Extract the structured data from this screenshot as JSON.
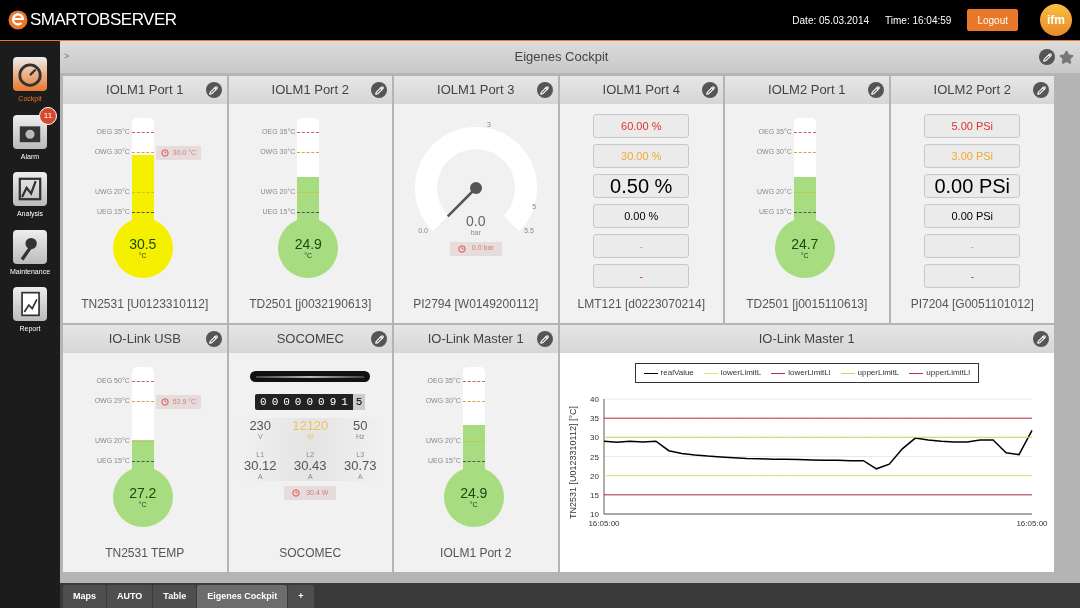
{
  "header": {
    "brand": "SMARTOBSERVER",
    "date": "Date: 05.03.2014",
    "time": "Time: 16:04:59",
    "logout": "Logout",
    "logo_text": "ifm"
  },
  "sidebar": {
    "items": [
      {
        "label": "Cockpit",
        "selected": true
      },
      {
        "label": "Alarm",
        "selected": false,
        "badge": "11"
      },
      {
        "label": "Analysis",
        "selected": false
      },
      {
        "label": "Maintenance",
        "selected": false
      },
      {
        "label": "Report",
        "selected": false
      }
    ]
  },
  "page": {
    "breadcrumb": ">",
    "title": "Eigenes Cockpit"
  },
  "cards": [
    {
      "kind": "thermometer",
      "title": "IOLM1 Port 1",
      "color": "#f5f000",
      "level": 0.69,
      "marks": [
        "OEG 35°C",
        "OWG 30°C",
        "UWG 20°C",
        "UEG 15°C"
      ],
      "value": "30.5",
      "unit": "°C",
      "alarm": "30.0 °C",
      "footer": "TN2531 [U0123310112]"
    },
    {
      "kind": "thermometer",
      "title": "IOLM1 Port 2",
      "color": "#a8dc80",
      "level": 0.5,
      "marks": [
        "OEG 35°C",
        "OWG 30°C",
        "UWG 20°C",
        "UEG 15°C"
      ],
      "value": "24.9",
      "unit": "°C",
      "footer": "TD2501 [j0032190613]"
    },
    {
      "kind": "gauge",
      "title": "IOLM1 Port 3",
      "scale_min": "0.0",
      "scale_max": "5.5",
      "ticks": [
        "3",
        "5"
      ],
      "value": "0.0",
      "unit": "bar",
      "alarm": "0.0 bar",
      "footer": "PI2794 [W0149200112]"
    },
    {
      "kind": "values",
      "title": "IOLM1 Port 4",
      "entries": [
        {
          "kind": "alarm",
          "text": "60.00 %"
        },
        {
          "kind": "warning",
          "text": "30.00 %"
        },
        {
          "kind": "current",
          "text": "0.50 %"
        },
        {
          "kind": "value",
          "text": "0.00 %"
        },
        {
          "kind": "warning",
          "text": "-"
        },
        {
          "kind": "alarm",
          "text": "-"
        }
      ],
      "footer": "LMT121 [d0223070214]"
    },
    {
      "kind": "thermometer",
      "title": "IOLM2 Port 1",
      "color": "#a8dc80",
      "level": 0.5,
      "marks": [
        "OEG 35°C",
        "OWG 30°C",
        "UWG 20°C",
        "UEG 15°C"
      ],
      "value": "24.7",
      "unit": "°C",
      "footer": "TD2501 [j0015110613]"
    },
    {
      "kind": "values",
      "title": "IOLM2 Port 2",
      "entries": [
        {
          "kind": "alarm",
          "text": "5.00 PSi"
        },
        {
          "kind": "warning",
          "text": "3.00 PSi"
        },
        {
          "kind": "current",
          "text": "0.00 PSi"
        },
        {
          "kind": "value",
          "text": "0.00 PSi"
        },
        {
          "kind": "warning",
          "text": "-"
        },
        {
          "kind": "alarm",
          "text": "-"
        }
      ],
      "footer": "PI7204 [G0051101012]"
    },
    {
      "kind": "thermometer",
      "title": "IO-Link USB",
      "color": "#a8dc80",
      "level": 0.38,
      "marks": [
        "OEG 50°C",
        "OWG 29°C",
        "UWG 20°C",
        "UEG 15°C"
      ],
      "value": "27.2",
      "unit": "°C",
      "alarm": "52.9 °C",
      "footer": "TN2531 TEMP"
    },
    {
      "kind": "energy",
      "title": "SOCOMEC",
      "counter": "00000091",
      "counter_fraction": "5",
      "readings": [
        {
          "value": "230",
          "unit": "V",
          "highlight": false
        },
        {
          "value": "12120",
          "unit": "W",
          "highlight": true
        },
        {
          "value": "50",
          "unit": "Hz",
          "highlight": false
        }
      ],
      "phases": [
        {
          "label": "L1",
          "value": "30.12",
          "unit": "A"
        },
        {
          "label": "L2",
          "value": "30.43",
          "unit": "A"
        },
        {
          "label": "L3",
          "value": "30.73",
          "unit": "A"
        }
      ],
      "alarm": "30.4 W",
      "footer": "SOCOMEC"
    },
    {
      "kind": "thermometer",
      "title": "IO-Link Master 1",
      "color": "#a8dc80",
      "level": 0.51,
      "marks": [
        "OEG 35°C",
        "OWG 30°C",
        "UWG 20°C",
        "UEG 15°C"
      ],
      "value": "24.9",
      "unit": "°C",
      "footer": "IOLM1 Port 2"
    },
    {
      "kind": "chart",
      "title": "IO-Link Master 1",
      "chart_data": {
        "type": "line",
        "ylabel": "TN2531 [U0123310112] [°C]",
        "categories": [
          "16:05:00",
          null,
          null,
          null,
          null,
          null,
          null,
          null,
          null,
          null,
          null,
          null,
          null,
          null,
          null,
          null,
          null,
          null,
          null,
          null,
          null,
          null,
          null,
          null,
          null,
          null,
          null,
          null,
          null,
          null,
          null,
          null,
          null,
          "16:05:00"
        ],
        "ylim": [
          10,
          40
        ],
        "yticks": [
          10,
          15,
          20,
          25,
          30,
          35,
          40
        ],
        "grid": true,
        "series": [
          {
            "name": "realValue",
            "color": "#000000",
            "values": [
              29,
              28.7,
              29,
              28.8,
              29,
              26.5,
              25.8,
              25.4,
              25.1,
              24.9,
              24.7,
              24.5,
              24.4,
              24.3,
              24.3,
              24.2,
              24.1,
              24.0,
              24.0,
              23.9,
              23.9,
              21.8,
              23,
              27,
              29.8,
              29.3,
              29,
              28.8,
              28.8,
              29.3,
              29.3,
              26,
              25.5,
              31.8
            ]
          },
          {
            "name": "lowerLimitL",
            "color": "#e8e070",
            "values": [
              20,
              20,
              20,
              20,
              20,
              20,
              20,
              20,
              20,
              20,
              20,
              20,
              20,
              20,
              20,
              20,
              20,
              20,
              20,
              20,
              20,
              20,
              20,
              20,
              20,
              20,
              20,
              20,
              20,
              20,
              20,
              20,
              20,
              20
            ]
          },
          {
            "name": "lowerLimitLl",
            "color": "#b03040",
            "values": [
              15,
              15,
              15,
              15,
              15,
              15,
              15,
              15,
              15,
              15,
              15,
              15,
              15,
              15,
              15,
              15,
              15,
              15,
              15,
              15,
              15,
              15,
              15,
              15,
              15,
              15,
              15,
              15,
              15,
              15,
              15,
              15,
              15,
              15
            ]
          },
          {
            "name": "upperLimitL",
            "color": "#d8d060",
            "values": [
              30,
              30,
              30,
              30,
              30,
              30,
              30,
              30,
              30,
              30,
              30,
              30,
              30,
              30,
              30,
              30,
              30,
              30,
              30,
              30,
              30,
              30,
              30,
              30,
              30,
              30,
              30,
              30,
              30,
              30,
              30,
              30,
              30,
              30
            ]
          },
          {
            "name": "upperLimitLl",
            "color": "#c03040",
            "values": [
              35,
              35,
              35,
              35,
              35,
              35,
              35,
              35,
              35,
              35,
              35,
              35,
              35,
              35,
              35,
              35,
              35,
              35,
              35,
              35,
              35,
              35,
              35,
              35,
              35,
              35,
              35,
              35,
              35,
              35,
              35,
              35,
              35,
              35
            ]
          }
        ]
      }
    }
  ],
  "bottom_tabs": [
    {
      "label": "Maps",
      "selected": false
    },
    {
      "label": "AUTO",
      "selected": false
    },
    {
      "label": "Table",
      "selected": false
    },
    {
      "label": "Eigenes Cockpit",
      "selected": true
    },
    {
      "label": "+",
      "selected": false
    }
  ]
}
